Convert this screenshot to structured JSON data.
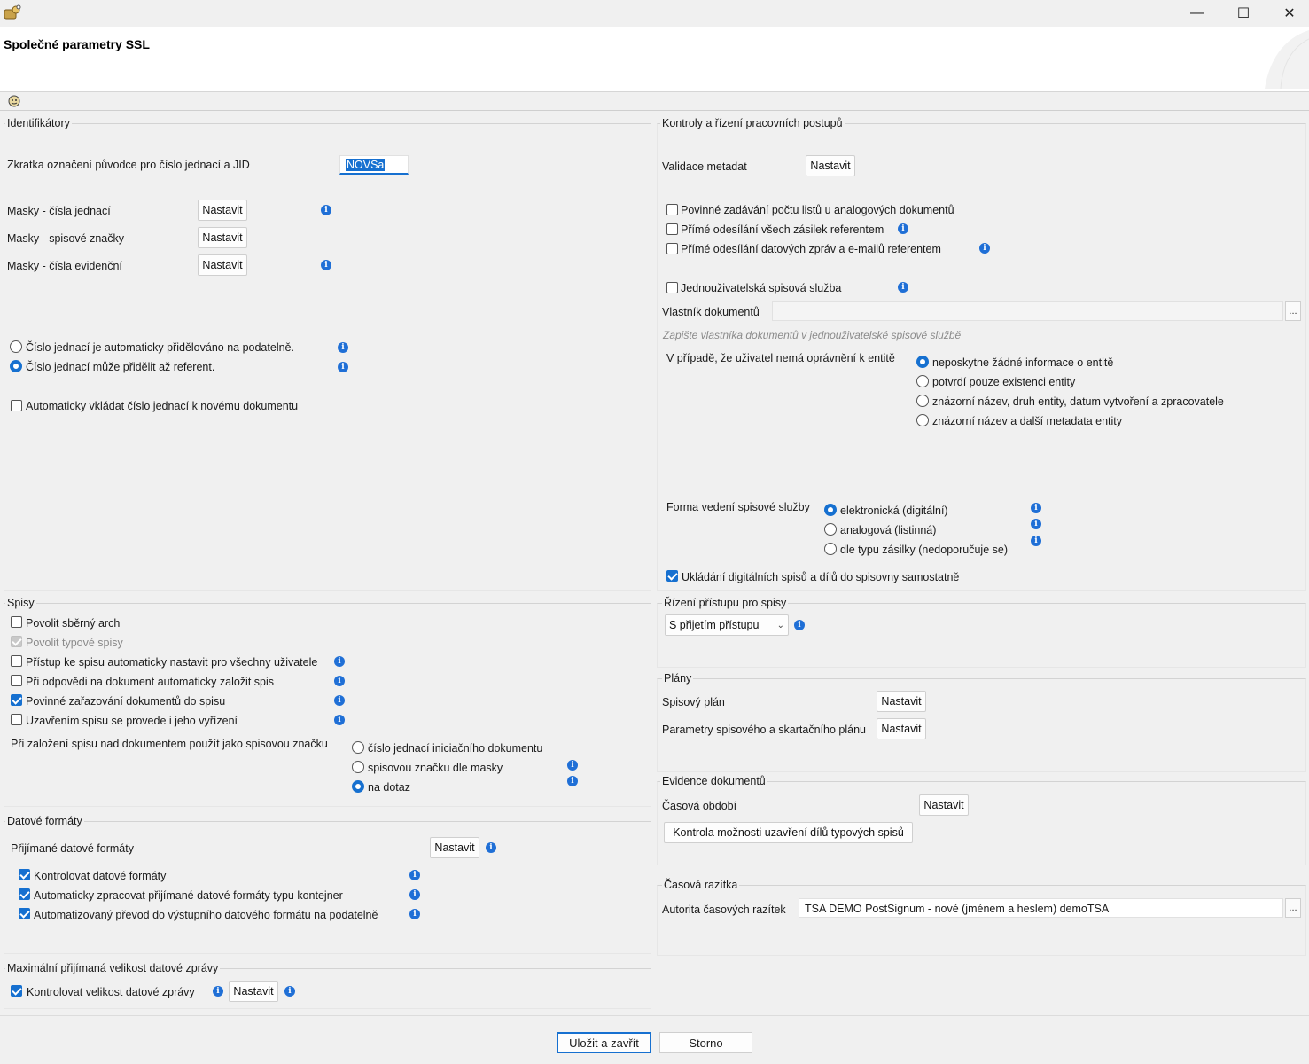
{
  "window": {
    "title": "Společné parametry SSL",
    "app_icon": "app-icon",
    "toolbar_icon": "help-icon",
    "controls": {
      "minimize": "—",
      "maximize": "☐",
      "close": "✕"
    }
  },
  "colors": {
    "accent": "#1670d0",
    "info": "#1f6fd6",
    "background": "#f0f0f0"
  },
  "identifikatory": {
    "title": "Identifikátory",
    "zkratka_label": "Zkratka označení původce pro číslo jednací a JID",
    "zkratka_value": "NOVSa",
    "masks": [
      {
        "label": "Masky - čísla jednací",
        "button": "Nastavit",
        "info": true
      },
      {
        "label": "Masky - spisové značky",
        "button": "Nastavit",
        "info": false
      },
      {
        "label": "Masky - čísla evidenční",
        "button": "Nastavit",
        "info": true
      }
    ],
    "radios": [
      {
        "label": "Číslo jednací je automaticky přidělováno na podatelně.",
        "selected": false
      },
      {
        "label": "Číslo jednací může přidělit až referent.",
        "selected": true
      }
    ],
    "auto_insert_label": "Automaticky vkládat číslo jednací k novému dokumentu",
    "auto_insert_checked": false
  },
  "kontroly": {
    "title": "Kontroly a řízení pracovních postupů",
    "validace_label": "Validace metadat",
    "validace_button": "Nastavit",
    "checkboxes": [
      {
        "label": "Povinné zadávání počtu listů u analogových dokumentů",
        "checked": false
      },
      {
        "label": "Přímé odesílání všech zásilek referentem",
        "checked": false
      },
      {
        "label": "Přímé odesílání datových zpráv a e-mailů referentem",
        "checked": false
      }
    ],
    "jednouzivatelska_label": "Jednouživatelská spisová služba",
    "jednouzivatelska_checked": false,
    "vlastnik_label": "Vlastník dokumentů",
    "vlastnik_value": "",
    "vlastnik_hint": "Zapište vlastníka dokumentů v jednouživatelské spisové službě",
    "opravneni_label": "V případě, že uživatel nemá oprávnění k entitě",
    "opravneni_options": [
      {
        "label": "neposkytne žádné informace o entitě",
        "selected": true
      },
      {
        "label": "potvrdí pouze existenci entity",
        "selected": false
      },
      {
        "label": "znázorní název, druh entity, datum vytvoření a zpracovatele",
        "selected": false
      },
      {
        "label": "znázorní název a další metadata entity",
        "selected": false
      }
    ],
    "forma_label": "Forma vedení spisové služby",
    "forma_options": [
      {
        "label": "elektronická (digitální)",
        "selected": true
      },
      {
        "label": "analogová (listinná)",
        "selected": false
      },
      {
        "label": "dle typu zásilky (nedoporučuje se)",
        "selected": false
      }
    ],
    "ukladani_label": "Ukládání digitálních spisů a dílů do spisovny samostatně",
    "ukladani_checked": true
  },
  "spisy": {
    "title": "Spisy",
    "checkboxes": [
      {
        "label": "Povolit sběrný arch",
        "checked": false,
        "disabled": false,
        "info": false
      },
      {
        "label": "Povolit typové spisy",
        "checked": true,
        "disabled": true,
        "info": false
      },
      {
        "label": "Přístup ke spisu automaticky nastavit pro všechny uživatele",
        "checked": false,
        "disabled": false,
        "info": true
      },
      {
        "label": "Při odpovědi na dokument automaticky založit spis",
        "checked": false,
        "disabled": false,
        "info": true
      },
      {
        "label": "Povinné zařazování dokumentů do spisu",
        "checked": true,
        "disabled": false,
        "info": true
      },
      {
        "label": "Uzavřením spisu se provede i jeho vyřízení",
        "checked": false,
        "disabled": false,
        "info": true
      }
    ],
    "zalozeni_label": "Při založení spisu nad dokumentem použít jako spisovou značku",
    "zalozeni_options": [
      {
        "label": "číslo jednací iniciačního dokumentu",
        "selected": false
      },
      {
        "label": "spisovou značku dle masky",
        "selected": false
      },
      {
        "label": "na dotaz",
        "selected": true
      }
    ]
  },
  "rizeni_pristupu": {
    "title": "Řízení přístupu pro spisy",
    "selected": "S přijetím přístupu"
  },
  "plany": {
    "title": "Plány",
    "items": [
      {
        "label": "Spisový plán",
        "button": "Nastavit"
      },
      {
        "label": "Parametry spisového a skartačního plánu",
        "button": "Nastavit"
      }
    ]
  },
  "datove_formaty": {
    "title": "Datové formáty",
    "prijimane_label": "Přijímané datové formáty",
    "prijimane_button": "Nastavit",
    "checkboxes": [
      {
        "label": "Kontrolovat datové formáty",
        "checked": true
      },
      {
        "label": "Automaticky zpracovat přijímané datové formáty typu kontejner",
        "checked": true
      },
      {
        "label": "Automatizovaný převod do výstupního datového formátu na podatelně",
        "checked": true
      }
    ]
  },
  "evidence": {
    "title": "Evidence dokumentů",
    "casova_obdobi_label": "Časová období",
    "casova_obdobi_button": "Nastavit",
    "kontrola_button": "Kontrola možnosti uzavření dílů typových spisů"
  },
  "casova_razitka": {
    "title": "Časová razítka",
    "autorita_label": "Autorita časových razítek",
    "autorita_value": "TSA DEMO PostSignum - nové (jménem a heslem) demoTSA",
    "browse": "..."
  },
  "max_velikost": {
    "title": "Maximální přijímaná velikost datové zprávy",
    "kontrolovat_label": "Kontrolovat velikost datové zprávy",
    "kontrolovat_checked": true,
    "button": "Nastavit"
  },
  "footer": {
    "save_label": "Uložit a zavřít",
    "cancel_label": "Storno"
  }
}
